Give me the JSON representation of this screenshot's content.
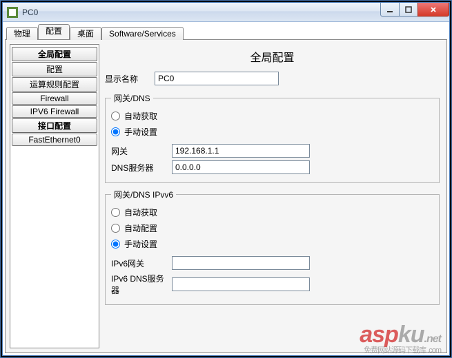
{
  "window": {
    "title": "PC0"
  },
  "tabs": [
    {
      "label": "物理"
    },
    {
      "label": "配置"
    },
    {
      "label": "桌面"
    },
    {
      "label": "Software/Services"
    }
  ],
  "sidebar": {
    "header1": "全局配置",
    "items1": [
      "配置",
      "运算规则配置",
      "Firewall",
      "IPV6 Firewall"
    ],
    "header2": "接口配置",
    "items2": [
      "FastEthernet0"
    ]
  },
  "main": {
    "title": "全局配置",
    "displayName": {
      "label": "显示名称",
      "value": "PC0"
    },
    "gatewayDns": {
      "legend": "网关/DNS",
      "auto": "自动获取",
      "manual": "手动设置",
      "selected": "manual",
      "gateway": {
        "label": "网关",
        "value": "192.168.1.1"
      },
      "dns": {
        "label": "DNS服务器",
        "value": "0.0.0.0"
      }
    },
    "gatewayDns6": {
      "legend": "网关/DNS IPvv6",
      "auto": "自动获取",
      "autoconf": "自动配置",
      "manual": "手动设置",
      "selected": "manual",
      "gateway": {
        "label": "IPv6网关",
        "value": ""
      },
      "dns": {
        "label": "IPv6 DNS服务器",
        "value": ""
      }
    }
  },
  "watermark": {
    "a": "asp",
    "b": "ku",
    "c": ".net",
    "d": "免费网站源码下载库 .com"
  }
}
